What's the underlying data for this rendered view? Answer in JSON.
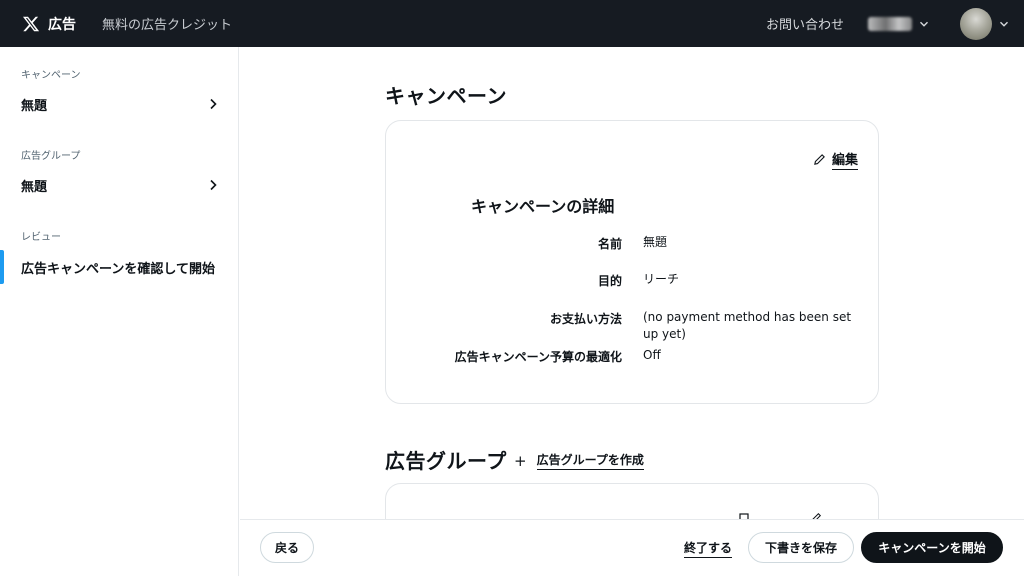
{
  "topbar": {
    "brand": "広告",
    "credit": "無料の広告クレジット",
    "contact": "お問い合わせ",
    "logo_icon": "x-logo-icon",
    "account_chevron_icon": "chevron-down-icon"
  },
  "sidebar": {
    "campaign_section": "キャンペーン",
    "campaign_item": "無題",
    "adgroup_section": "広告グループ",
    "adgroup_item": "無題",
    "review_section": "レビュー",
    "review_item": "広告キャンペーンを確認して開始"
  },
  "main": {
    "campaign_heading": "キャンペーン",
    "edit_label": "編集",
    "details_title": "キャンペーンの詳細",
    "details": [
      {
        "label": "名前",
        "value": "無題"
      },
      {
        "label": "目的",
        "value": "リーチ"
      },
      {
        "label": "お支払い方法",
        "value": "(no payment method has been set up yet)"
      },
      {
        "label": "広告キャンペーン予算の最適化",
        "value": "Off"
      }
    ],
    "adgroup_heading": "広告グループ",
    "create_adgroup_label": "広告グループを作成"
  },
  "footer": {
    "back": "戻る",
    "finish": "終了する",
    "save_draft": "下書きを保存",
    "launch": "キャンペーンを開始"
  },
  "colors": {
    "topbar_bg": "#161b22",
    "accent": "#1d9bf0",
    "primary_button": "#0f1419"
  }
}
